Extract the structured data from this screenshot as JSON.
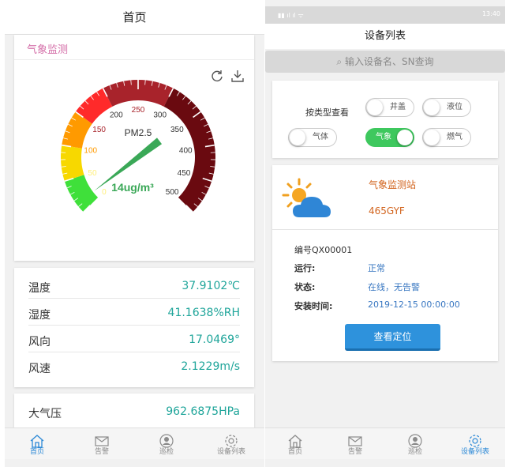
{
  "home": {
    "title": "首页",
    "weather_card_title": "气象监测",
    "gauge": {
      "name": "PM2.5",
      "value": 14,
      "reading": "14ug/m³",
      "min": 0,
      "max": 500,
      "ticks": [
        "0",
        "50",
        "100",
        "150",
        "200",
        "250",
        "300",
        "350",
        "400",
        "450",
        "500"
      ]
    },
    "readings": [
      {
        "label": "温度",
        "value": "37.9102℃"
      },
      {
        "label": "湿度",
        "value": "41.1638%RH"
      },
      {
        "label": "风向",
        "value": "17.0469°"
      },
      {
        "label": "风速",
        "value": "2.1229m/s"
      }
    ],
    "pressure": {
      "label": "大气压",
      "value": "962.6875HPa"
    },
    "tabs": [
      "首页",
      "告警",
      "巡检",
      "设备列表"
    ]
  },
  "device_list": {
    "status_time": "13:40",
    "title": "设备列表",
    "search_placeholder": "输入设备名、SN查询",
    "filter_label": "按类型查看",
    "filters": [
      {
        "label": "井盖",
        "on": false
      },
      {
        "label": "液位",
        "on": false
      },
      {
        "label": "气体",
        "on": false
      },
      {
        "label": "气象",
        "on": true
      },
      {
        "label": "燃气",
        "on": false
      }
    ],
    "station": {
      "name": "气象监测站",
      "sn": "465GYF",
      "id": "编号QX00001",
      "run_label": "运行:",
      "run_value": "正常",
      "state_label": "状态:",
      "state_value": "在线，无告警",
      "install_label": "安装时间:",
      "install_value": "2019-12-15 00:00:00",
      "locate_button": "查看定位"
    },
    "tabs": [
      "首页",
      "告警",
      "巡检",
      "设备列表"
    ]
  },
  "colors": {
    "accent": "#2a88d6",
    "teal": "#1fa59a",
    "orange": "#d2641e",
    "green": "#3ec85e"
  }
}
